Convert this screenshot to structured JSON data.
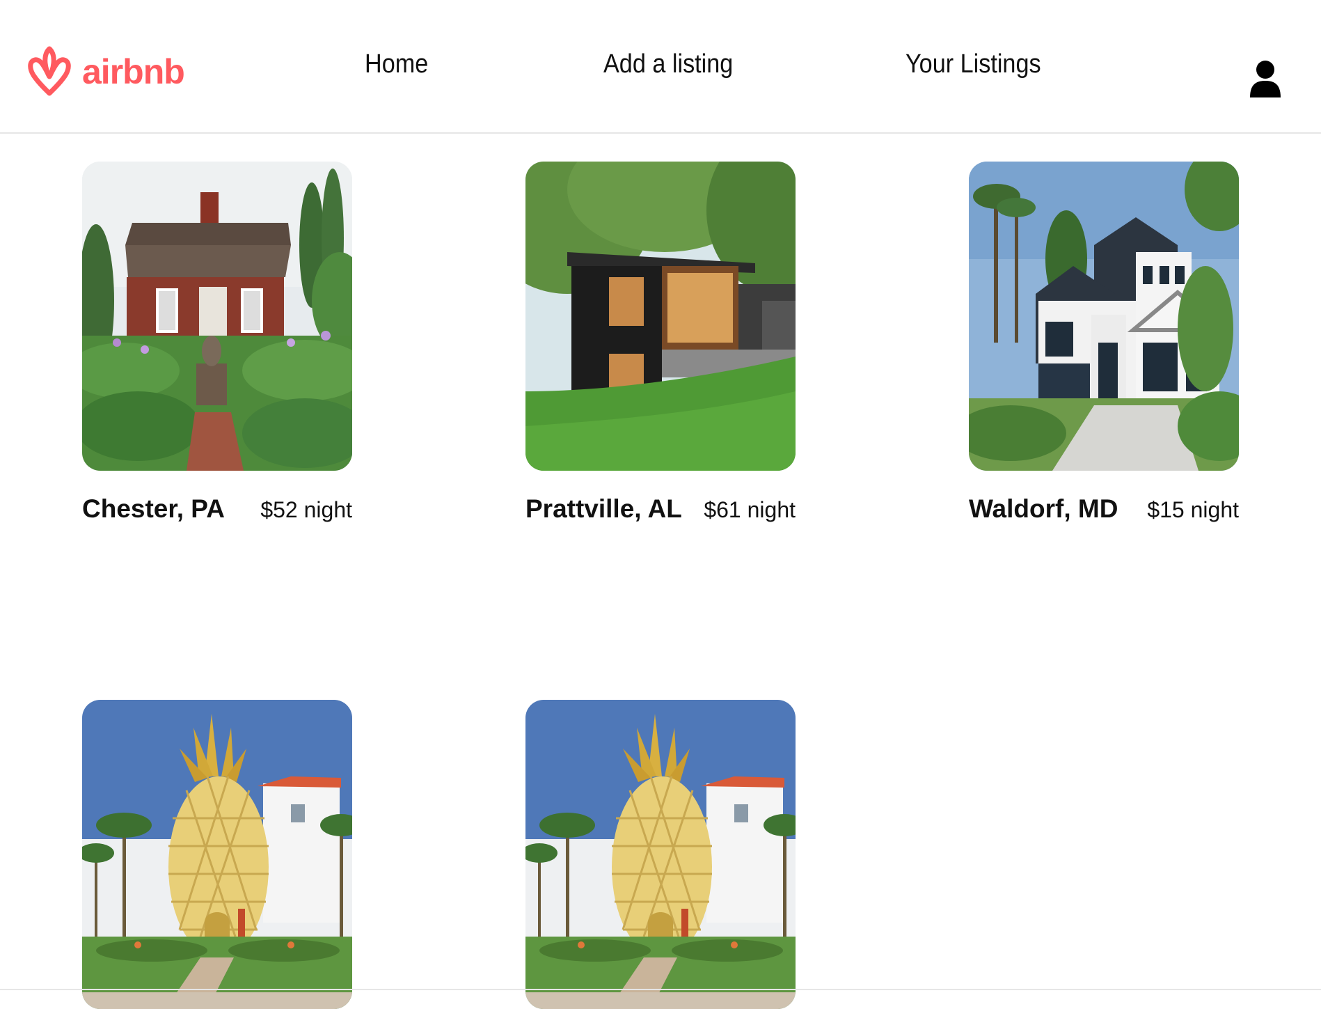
{
  "brand": {
    "name": "airbnb",
    "color": "#ff5a5f"
  },
  "nav": {
    "home": "Home",
    "add_listing": "Add a listing",
    "your_listings": "Your Listings"
  },
  "user_icon": "user-icon",
  "listings": [
    {
      "location": "Chester, PA",
      "price": "$52 night",
      "image": "red-cottage-garden"
    },
    {
      "location": "Prattville, AL",
      "price": "$61 night",
      "image": "modern-black-house"
    },
    {
      "location": "Waldorf, MD",
      "price": "$15 night",
      "image": "white-modern-house"
    },
    {
      "image": "pineapple-house"
    },
    {
      "image": "pineapple-house"
    }
  ]
}
